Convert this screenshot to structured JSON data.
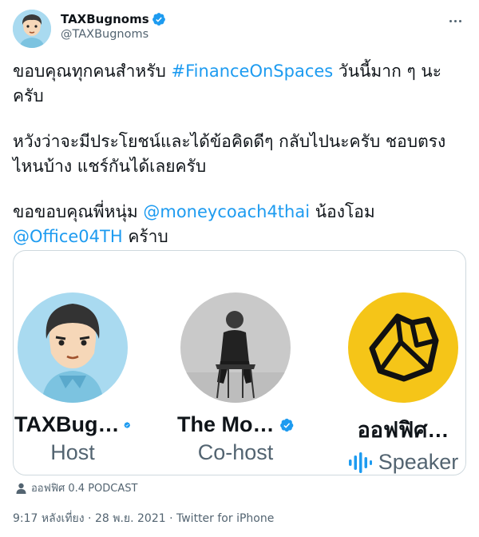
{
  "author": {
    "display_name": "TAXBugnoms",
    "handle": "@TAXBugnoms",
    "verified_icon": "verified-badge-icon",
    "more_icon": "more-horizontal-icon"
  },
  "tweet": {
    "line1_text": "ขอบคุณทุกคนสำหรับ ",
    "line1_hashtag": "#FinanceOnSpaces",
    "line1_rest": " วันนี้มาก ๆ นะครับ",
    "para2": "หวังว่าจะมีประโยชน์และได้ข้อคิดดีๆ กลับไปนะครับ ชอบตรงไหนบ้าง แชร์กันได้เลยครับ",
    "para3_text": "ขอขอบคุณพี่หนุ่ม ",
    "para3_mention1": "@moneycoach4thai",
    "para3_mid": " น้องโอม ",
    "para3_mention2": "@Office04TH",
    "para3_end": " คร้าบ"
  },
  "space_card": {
    "speakers": [
      {
        "name": "TAXBug…",
        "role": "Host",
        "verified": true
      },
      {
        "name": "The Mo…",
        "role": "Co-host",
        "verified": true
      },
      {
        "name": "ออฟฟิศ…",
        "role": "Speaker",
        "verified": false,
        "role_icon": "speaking-waveform-icon"
      }
    ],
    "accent_color": "#1d9bf0"
  },
  "space_label": {
    "icon": "user-icon",
    "text": "ออฟฟิศ 0.4 PODCAST"
  },
  "meta": {
    "time": "9:17 หลังเที่ยง",
    "separator1": " · ",
    "date": "28 พ.ย. 2021",
    "separator2": " · ",
    "client": "Twitter for iPhone"
  }
}
